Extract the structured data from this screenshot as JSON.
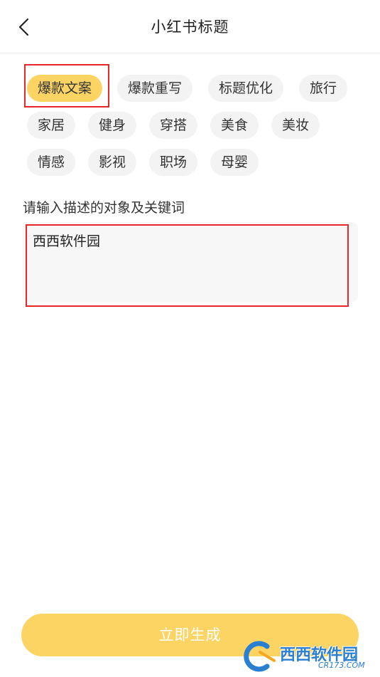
{
  "header": {
    "title": "小红书标题",
    "back_icon": "chevron-left-icon"
  },
  "tags": [
    {
      "label": "爆款文案",
      "selected": true
    },
    {
      "label": "爆款重写",
      "selected": false
    },
    {
      "label": "标题优化",
      "selected": false
    },
    {
      "label": "旅行",
      "selected": false
    },
    {
      "label": "家居",
      "selected": false
    },
    {
      "label": "健身",
      "selected": false
    },
    {
      "label": "穿搭",
      "selected": false
    },
    {
      "label": "美食",
      "selected": false
    },
    {
      "label": "美妆",
      "selected": false
    },
    {
      "label": "情感",
      "selected": false
    },
    {
      "label": "影视",
      "selected": false
    },
    {
      "label": "职场",
      "selected": false
    },
    {
      "label": "母婴",
      "selected": false
    }
  ],
  "input": {
    "label": "请输入描述的对象及关键词",
    "value": "西西软件园"
  },
  "generate_button": {
    "label": "立即生成"
  },
  "watermark": {
    "text": "西西软件园",
    "sub": "CR173.COM"
  },
  "colors": {
    "accent": "#fcd463",
    "highlight": "#e8262b",
    "tag_bg": "#f3f3f3",
    "watermark": "#2a7fd1"
  }
}
